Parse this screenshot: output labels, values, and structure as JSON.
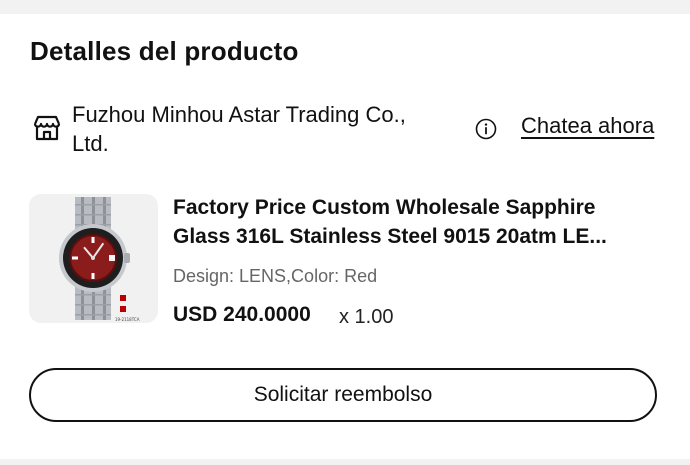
{
  "section": {
    "title": "Detalles del producto"
  },
  "seller": {
    "name_line1": "Fuzhou Minhou Astar Trading Co.,",
    "name_line2": "Ltd.",
    "store_icon": "store-icon",
    "info_icon": "info-icon",
    "chat_label": "Chatea ahora"
  },
  "product": {
    "title_line1": "Factory Price Custom Wholesale Sapphire",
    "title_line2": "Glass 316L Stainless Steel 9015 20atm LE...",
    "variant": "Design: LENS,Color: Red",
    "price": "USD 240.0000",
    "quantity": "x 1.00",
    "image_label": "19-2118TCA"
  },
  "actions": {
    "refund_label": "Solicitar reembolso"
  },
  "colors": {
    "background": "#f2f2f3",
    "card": "#ffffff",
    "text": "#111111",
    "secondary_text": "#666666",
    "dial_red": "#8a1c1c"
  }
}
